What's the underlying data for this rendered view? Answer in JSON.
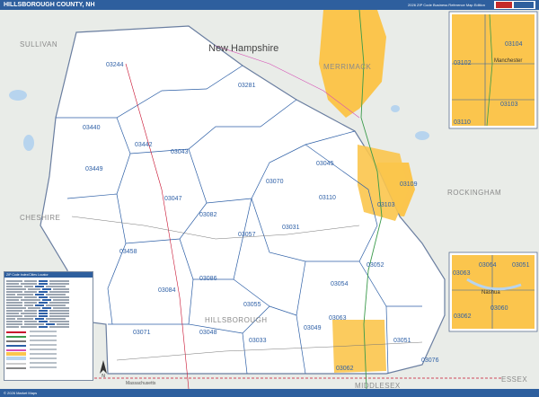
{
  "header": {
    "title": "HILLSBOROUGH COUNTY, NH",
    "edition": "2026 ZIP Code Business Reference Map Edition"
  },
  "colors": {
    "header_bar": "#2e5f9e",
    "zip_label": "#2d5fa6",
    "urban_area": "#fbc54d",
    "water": "#b7d4ee",
    "terrain": "#e9ece8",
    "county_fill": "#ffffff",
    "state_boundary": "#c8102e"
  },
  "state_label": "New Hampshire",
  "county_labels": {
    "sullivan": "SULLIVAN",
    "merrimack": "MERRIMACK",
    "cheshire": "CHESHIRE",
    "rockingham": "ROCKINGHAM",
    "hillsborough": "HILLSBOROUGH",
    "middlesex": "MIDDLESEX",
    "essex": "ESSEX"
  },
  "state_label_south": "Massachusetts",
  "zip_codes": [
    "03244",
    "03281",
    "03440",
    "03442",
    "03043",
    "03449",
    "03045",
    "03070",
    "03047",
    "03110",
    "03109",
    "03082",
    "03103",
    "03057",
    "03031",
    "03458",
    "03086",
    "03084",
    "03052",
    "03054",
    "03055",
    "03049",
    "03048",
    "03071",
    "03033",
    "03063",
    "03051",
    "03076",
    "03062"
  ],
  "inset_top": {
    "city": "Manchester",
    "zips": [
      "03104",
      "03102",
      "03103",
      "03110"
    ]
  },
  "inset_bottom": {
    "city": "Nashua",
    "zips": [
      "03064",
      "03051",
      "03063",
      "03060",
      "03062"
    ]
  },
  "legend": {
    "title": "ZIP Code Index/Cities Locator",
    "compass_letter": "N"
  },
  "footer": {
    "copyright": "© 2026 Market Maps"
  }
}
